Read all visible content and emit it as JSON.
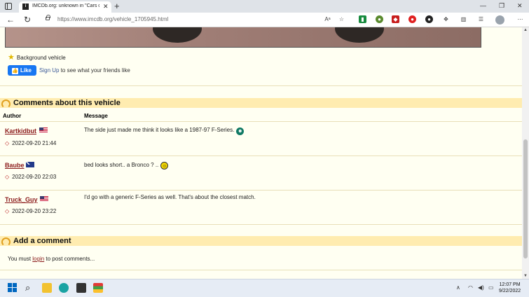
{
  "browser": {
    "tab_title": "IMCDb.org: unknown in \"Cars on",
    "tab_favicon": "imcdb-favicon",
    "url_host": "https://www.imcdb.org",
    "url_path": "/vehicle_1705945.html"
  },
  "vehicle": {
    "role_label": "Background vehicle"
  },
  "facebook": {
    "like_label": "Like",
    "signup_link": "Sign Up",
    "signup_suffix": " to see what your friends like"
  },
  "comments": {
    "section_title": "Comments about this vehicle",
    "col_author": "Author",
    "col_message": "Message",
    "rows": [
      {
        "author": "Kartkidbut",
        "flag": "us-flag",
        "timestamp": "2022-09-20 21:44",
        "message": "The side just made me think it looks like a 1987-97 F-Series.",
        "emote": "teal-smiley",
        "emote_glyph": "☻"
      },
      {
        "author": "Baube",
        "flag": "au-flag",
        "timestamp": "2022-09-20 22:03",
        "message": "bed looks short.. a Bronco ? ..",
        "emote": "yellow-smiley",
        "emote_glyph": "☺"
      },
      {
        "author": "Truck_Guy",
        "flag": "us-flag",
        "timestamp": "2022-09-20 23:22",
        "message": "I'd go with a generic F-Series as well. That's about the closest match.",
        "emote": "",
        "emote_glyph": ""
      }
    ]
  },
  "add_comment": {
    "section_title": "Add a comment",
    "prefix": "You must ",
    "login_link": "login",
    "suffix": " to post comments..."
  },
  "taskbar": {
    "time": "12:07 PM",
    "date": "9/22/2022"
  },
  "colors": {
    "page_bg": "#fffff2",
    "section_header_bg": "#ffecb0",
    "author_link": "#8b1a1a",
    "facebook_blue": "#1877f2"
  }
}
